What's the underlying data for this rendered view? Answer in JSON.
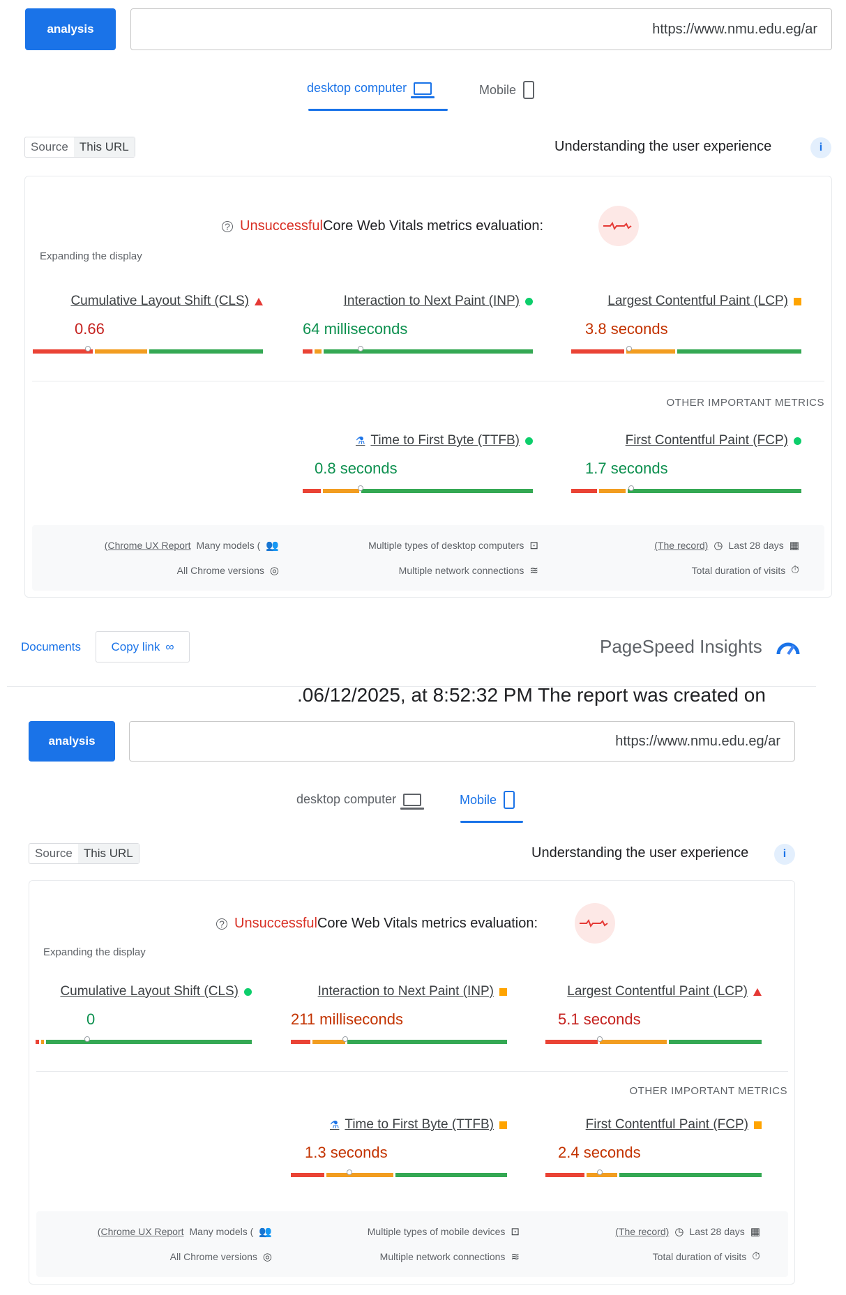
{
  "desktop_report": {
    "analyze_label": "analysis",
    "url": "https://www.nmu.edu.eg/ar",
    "tabs": {
      "desktop": "desktop computer",
      "mobile": "Mobile",
      "active": "desktop"
    },
    "source": {
      "label": "Source",
      "selected": "This URL"
    },
    "ux_title": "Understanding the user experience",
    "assessment": {
      "status": "Unsuccessful",
      "text": "Core Web Vitals metrics evaluation:"
    },
    "expand_label": "Expanding the display",
    "metrics": {
      "cls": {
        "title": "Cumulative Layout Shift (CLS)",
        "value": "0.66",
        "rating": "poor",
        "marker_pct": 24
      },
      "inp": {
        "title": "Interaction to Next Paint (INP)",
        "value": "64 milliseconds",
        "rating": "good",
        "marker_pct": 25
      },
      "lcp": {
        "title": "Largest Contentful Paint (LCP)",
        "value": "3.8 seconds",
        "rating": "average",
        "marker_pct": 25
      }
    },
    "other_label": "OTHER IMPORTANT METRICS",
    "other_metrics": {
      "ttfb": {
        "title": "Time to First Byte (TTFB)",
        "value": "0.8 seconds",
        "rating": "good",
        "marker_pct": 25
      },
      "fcp": {
        "title": "First Contentful Paint (FCP)",
        "value": "1.7 seconds",
        "rating": "good",
        "marker_pct": 26
      }
    },
    "footer": {
      "crux": "(Chrome UX Report",
      "many_models": "Many models (",
      "devices": "Multiple types of desktop computers",
      "record": "(The record)",
      "last_days": "Last 28 days",
      "chrome_versions": "All Chrome versions",
      "network": "Multiple network connections",
      "visits": "Total duration of visits"
    }
  },
  "middle": {
    "documents_label": "Documents",
    "copy_link_label": "Copy link",
    "psi_title": "PageSpeed Insights",
    "report_time": ".06/12/2025, at 8:52:32 PM The report was created on"
  },
  "mobile_report": {
    "analyze_label": "analysis",
    "url": "https://www.nmu.edu.eg/ar",
    "tabs": {
      "desktop": "desktop computer",
      "mobile": "Mobile",
      "active": "mobile"
    },
    "source": {
      "label": "Source",
      "selected": "This URL"
    },
    "ux_title": "Understanding the user experience",
    "assessment": {
      "status": "Unsuccessful",
      "text": "Core Web Vitals metrics evaluation:"
    },
    "expand_label": "Expanding the display",
    "metrics": {
      "cls": {
        "title": "Cumulative Layout Shift (CLS)",
        "value": "0",
        "rating": "good",
        "marker_pct": 24
      },
      "inp": {
        "title": "Interaction to Next Paint (INP)",
        "value": "211 milliseconds",
        "rating": "average",
        "marker_pct": 25
      },
      "lcp": {
        "title": "Largest Contentful Paint (LCP)",
        "value": "5.1 seconds",
        "rating": "poor",
        "marker_pct": 25
      }
    },
    "other_label": "OTHER IMPORTANT METRICS",
    "other_metrics": {
      "ttfb": {
        "title": "Time to First Byte (TTFB)",
        "value": "1.3 seconds",
        "rating": "average",
        "marker_pct": 27
      },
      "fcp": {
        "title": "First Contentful Paint (FCP)",
        "value": "2.4 seconds",
        "rating": "average",
        "marker_pct": 25
      }
    },
    "footer": {
      "crux": "(Chrome UX Report",
      "many_models": "Many models (",
      "devices": "Multiple types of mobile devices",
      "record": "(The record)",
      "last_days": "Last 28 days",
      "chrome_versions": "All Chrome versions",
      "network": "Multiple network connections",
      "visits": "Total duration of visits"
    }
  },
  "colors": {
    "accent": "#1a73e8",
    "good": "#0cce6b",
    "average": "#ffa400",
    "poor": "#e53935"
  },
  "icons": [
    "desktop-icon",
    "mobile-icon",
    "ux-info-icon",
    "question-icon",
    "pulse-icon",
    "flask-icon",
    "users-icon",
    "devices-icon",
    "clock-icon",
    "calendar-icon",
    "chrome-icon",
    "wifi-icon",
    "timer-icon",
    "link-icon",
    "psi-logo-icon"
  ]
}
